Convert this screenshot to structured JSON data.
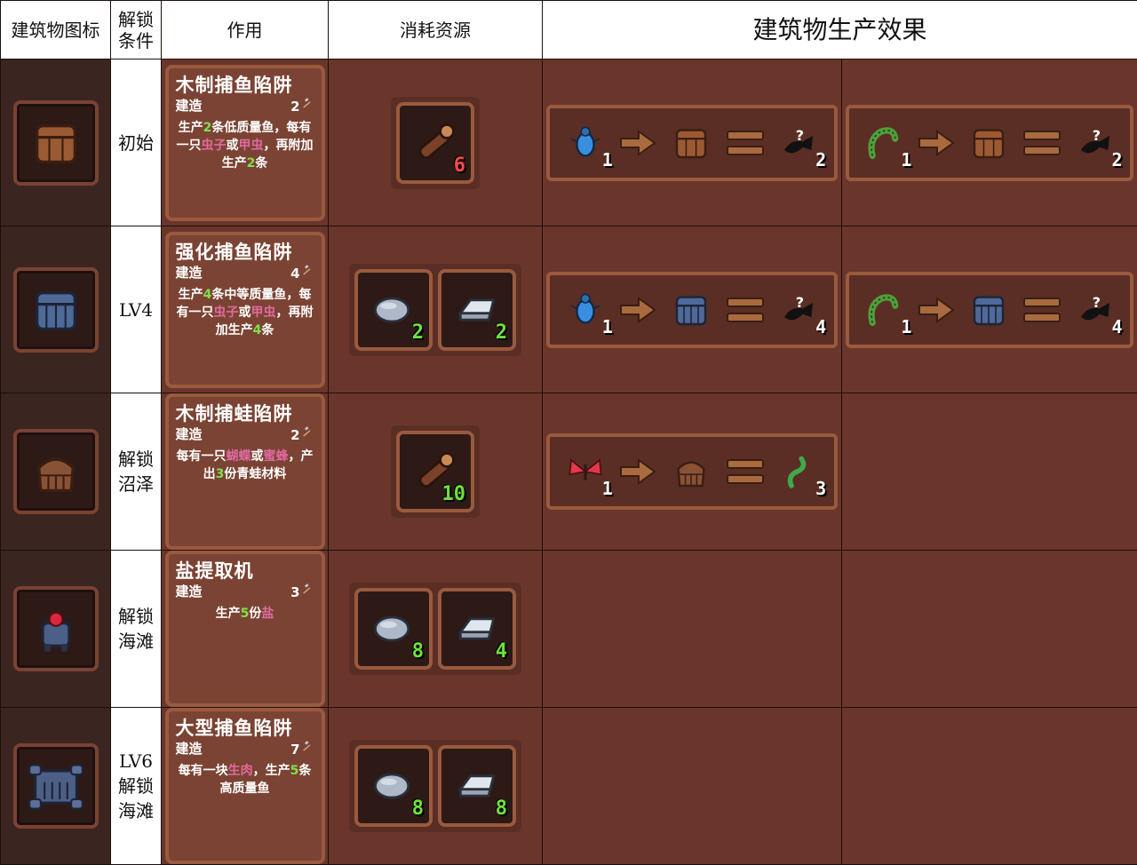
{
  "headers": {
    "icon": "建筑物图标",
    "unlock": "解锁条件",
    "usage": "作用",
    "cost": "消耗资源",
    "effect": "建筑物生产效果"
  },
  "rows": [
    {
      "unlock_lines": [
        "初始"
      ],
      "building_icon": "wooden-barrel-icon",
      "name": "木制捕鱼陷阱",
      "build_label": "建造",
      "build_value": "2",
      "desc_parts": [
        {
          "t": "生产"
        },
        {
          "t": "2",
          "c": "g"
        },
        {
          "t": "条低质量鱼，每有一只"
        },
        {
          "t": "虫子",
          "c": "p"
        },
        {
          "t": "或"
        },
        {
          "t": "甲虫",
          "c": "p"
        },
        {
          "t": "，再附加生产"
        },
        {
          "t": "2",
          "c": "g"
        },
        {
          "t": "条"
        }
      ],
      "costs": [
        {
          "icon": "log-icon",
          "value": "6",
          "color": "red"
        }
      ],
      "effects": [
        {
          "input": "beetle-icon",
          "in_n": "1",
          "building": "wooden-barrel-icon",
          "output": "unknown-fish-icon",
          "out_n": "2"
        },
        {
          "input": "worm-icon",
          "in_n": "1",
          "building": "wooden-barrel-icon",
          "output": "unknown-fish-icon",
          "out_n": "2"
        }
      ]
    },
    {
      "unlock_lines": [
        "LV4"
      ],
      "building_icon": "steel-barrel-icon",
      "name": "强化捕鱼陷阱",
      "build_label": "建造",
      "build_value": "4",
      "desc_parts": [
        {
          "t": "生产"
        },
        {
          "t": "4",
          "c": "g"
        },
        {
          "t": "条中等质量鱼，每有一只"
        },
        {
          "t": "虫子",
          "c": "p"
        },
        {
          "t": "或"
        },
        {
          "t": "甲虫",
          "c": "p"
        },
        {
          "t": "，再附加生产"
        },
        {
          "t": "4",
          "c": "g"
        },
        {
          "t": "条"
        }
      ],
      "costs": [
        {
          "icon": "stone-icon",
          "value": "2",
          "color": "green"
        },
        {
          "icon": "iron-ingot-icon",
          "value": "2",
          "color": "green"
        }
      ],
      "effects": [
        {
          "input": "beetle-icon",
          "in_n": "1",
          "building": "steel-barrel-icon",
          "output": "unknown-fish-icon",
          "out_n": "4"
        },
        {
          "input": "worm-icon",
          "in_n": "1",
          "building": "steel-barrel-icon",
          "output": "unknown-fish-icon",
          "out_n": "4"
        }
      ]
    },
    {
      "unlock_lines": [
        "解锁",
        "沼泽"
      ],
      "building_icon": "wooden-basket-icon",
      "name": "木制捕蛙陷阱",
      "build_label": "建造",
      "build_value": "2",
      "desc_parts": [
        {
          "t": "每有一只"
        },
        {
          "t": "蝴蝶",
          "c": "p"
        },
        {
          "t": "或"
        },
        {
          "t": "蜜蜂",
          "c": "p"
        },
        {
          "t": "，产出"
        },
        {
          "t": "3",
          "c": "g"
        },
        {
          "t": "份青蛙材料"
        }
      ],
      "costs": [
        {
          "icon": "log-icon",
          "value": "10",
          "color": "green"
        }
      ],
      "effects": [
        {
          "input": "butterfly-icon",
          "in_n": "1",
          "building": "wooden-basket-icon",
          "output": "frog-material-icon",
          "out_n": "3"
        }
      ]
    },
    {
      "unlock_lines": [
        "解锁",
        "海滩"
      ],
      "building_icon": "salt-extractor-icon",
      "name": "盐提取机",
      "build_label": "建造",
      "build_value": "3",
      "desc_parts": [
        {
          "t": "生产"
        },
        {
          "t": "5",
          "c": "g"
        },
        {
          "t": "份"
        },
        {
          "t": "盐",
          "c": "p"
        }
      ],
      "costs": [
        {
          "icon": "stone-icon",
          "value": "8",
          "color": "green"
        },
        {
          "icon": "iron-ingot-icon",
          "value": "4",
          "color": "green"
        }
      ],
      "effects": []
    },
    {
      "unlock_lines": [
        "LV6",
        "解锁",
        "海滩"
      ],
      "building_icon": "large-fish-trap-icon",
      "name": "大型捕鱼陷阱",
      "build_label": "建造",
      "build_value": "7",
      "desc_parts": [
        {
          "t": "每有一块"
        },
        {
          "t": "生肉",
          "c": "p"
        },
        {
          "t": "，生产"
        },
        {
          "t": "5",
          "c": "g"
        },
        {
          "t": "条高质量鱼"
        }
      ],
      "costs": [
        {
          "icon": "stone-icon",
          "value": "8",
          "color": "green"
        },
        {
          "icon": "iron-ingot-icon",
          "value": "8",
          "color": "green"
        }
      ],
      "effects": []
    }
  ],
  "colors": {
    "panel": "#6a362b",
    "card": "#7b4333",
    "border": "#9a5a3e",
    "highlight_green": "#7fe14a",
    "highlight_pink": "#e06aa0"
  }
}
